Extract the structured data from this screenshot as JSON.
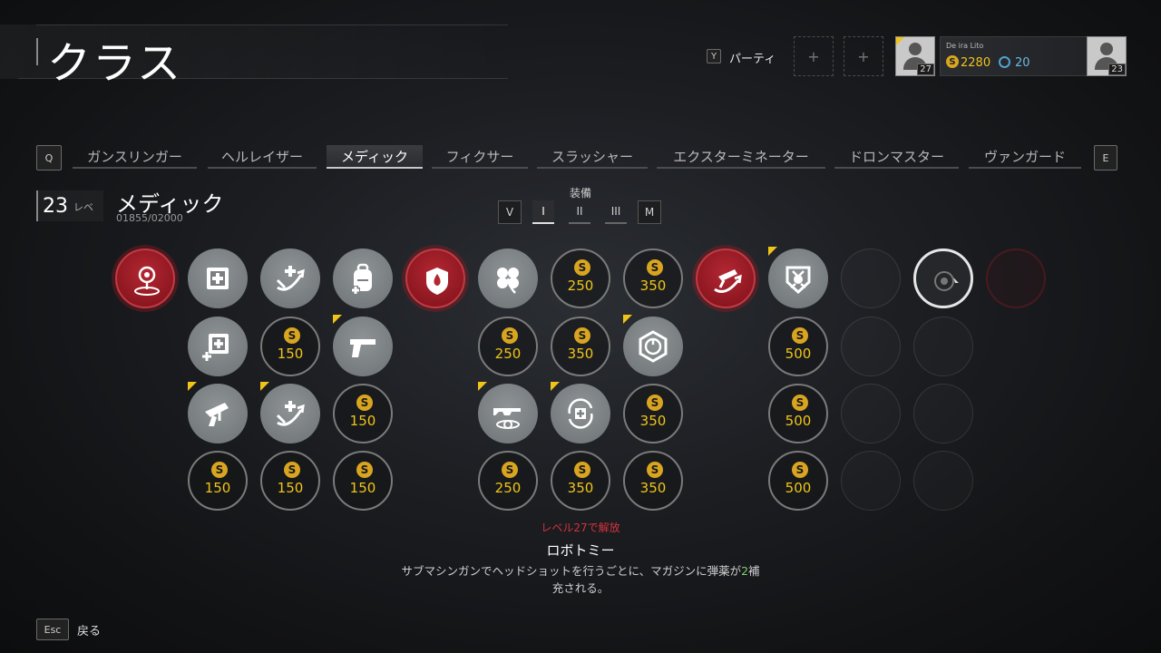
{
  "header": {
    "title": "クラス"
  },
  "party": {
    "key": "Y",
    "label": "パーティ",
    "slots": [
      "+",
      "+"
    ]
  },
  "player": {
    "level": "27"
  },
  "profile": {
    "name": "De ira Lito",
    "credits": "2280",
    "tokens": "20",
    "level": "23"
  },
  "tabs": {
    "prev_key": "Q",
    "next_key": "E",
    "items": [
      "ガンスリンガー",
      "ヘルレイザー",
      "メディック",
      "フィクサー",
      "スラッシャー",
      "エクスターミネーター",
      "ドロンマスター",
      "ヴァンガード"
    ],
    "active": "メディック"
  },
  "class_info": {
    "level": "23",
    "level_label": "レベ",
    "name": "メディック",
    "xp": "01855/02000"
  },
  "loadout": {
    "label": "装備",
    "buttons": [
      "V",
      "I",
      "II",
      "III",
      "M"
    ],
    "selected": "I"
  },
  "perk_tree": {
    "currency_symbol": "S",
    "rows": [
      [
        {
          "t": "red",
          "icon": "target"
        },
        {
          "t": "gray",
          "icon": "medkit"
        },
        {
          "t": "gray",
          "icon": "heal-arrow"
        },
        {
          "t": "gray",
          "icon": "backpack"
        },
        {
          "t": "red",
          "icon": "shield-drop"
        },
        {
          "t": "gray",
          "icon": "clover"
        },
        {
          "t": "cost",
          "cost": "250"
        },
        {
          "t": "cost",
          "cost": "350"
        },
        {
          "t": "red",
          "icon": "gun-arrow"
        },
        {
          "t": "gray",
          "icon": "badge",
          "new": true
        },
        {
          "t": "faint"
        },
        {
          "t": "sel"
        },
        {
          "t": "faint-red"
        }
      ],
      [
        null,
        {
          "t": "gray",
          "icon": "medkit-plus"
        },
        {
          "t": "cost",
          "cost": "150"
        },
        {
          "t": "gray",
          "icon": "pistol",
          "new": true
        },
        null,
        {
          "t": "cost",
          "cost": "250"
        },
        {
          "t": "cost",
          "cost": "350"
        },
        {
          "t": "gray",
          "icon": "hex",
          "new": true
        },
        null,
        {
          "t": "cost",
          "cost": "500"
        },
        {
          "t": "faint"
        },
        {
          "t": "faint"
        },
        null
      ],
      [
        null,
        {
          "t": "gray",
          "icon": "smg",
          "new": true
        },
        {
          "t": "gray",
          "icon": "heal-arrow",
          "new": true
        },
        {
          "t": "cost",
          "cost": "150"
        },
        null,
        {
          "t": "gray",
          "icon": "rifle",
          "new": true
        },
        {
          "t": "gray",
          "icon": "medkit-cycle",
          "new": true
        },
        {
          "t": "cost",
          "cost": "350"
        },
        null,
        {
          "t": "cost",
          "cost": "500"
        },
        {
          "t": "faint"
        },
        {
          "t": "faint"
        },
        null
      ],
      [
        null,
        {
          "t": "cost",
          "cost": "150"
        },
        {
          "t": "cost",
          "cost": "150"
        },
        {
          "t": "cost",
          "cost": "150"
        },
        null,
        {
          "t": "cost",
          "cost": "250"
        },
        {
          "t": "cost",
          "cost": "350"
        },
        {
          "t": "cost",
          "cost": "350"
        },
        null,
        {
          "t": "cost",
          "cost": "500"
        },
        {
          "t": "faint"
        },
        {
          "t": "faint"
        },
        null
      ]
    ]
  },
  "tooltip": {
    "unlock": "レベル27で解放",
    "name": "ロボトミー",
    "desc_before": "サブマシンガンでヘッドショットを行うごとに、マガジンに弾薬が",
    "desc_highlight": "2",
    "desc_after": "補充される。"
  },
  "footer": {
    "key": "Esc",
    "label": "戻る"
  },
  "colors": {
    "accent_gold": "#f0c419",
    "perk_red": "#b32732",
    "locked_red": "#d6323a",
    "highlight_green": "#7cd36c"
  }
}
